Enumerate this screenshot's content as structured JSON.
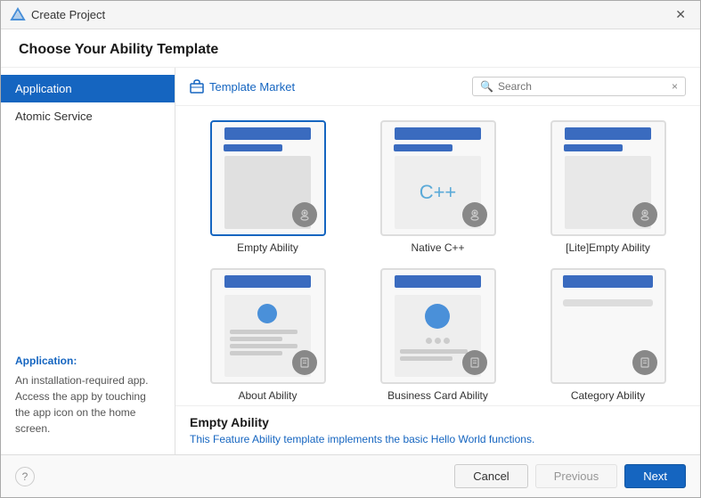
{
  "dialog": {
    "title": "Create Project",
    "heading": "Choose Your Ability Template"
  },
  "sidebar": {
    "items": [
      {
        "id": "application",
        "label": "Application",
        "active": true
      },
      {
        "id": "atomic-service",
        "label": "Atomic Service",
        "active": false
      }
    ],
    "description": {
      "title": "Application:",
      "text": "An installation-required app. Access the app by touching the app icon on the home screen."
    }
  },
  "toolbar": {
    "template_market_label": "Template Market",
    "search_placeholder": "Search",
    "search_clear_icon": "×"
  },
  "templates": [
    {
      "id": "empty-ability",
      "name": "Empty Ability",
      "selected": true,
      "type": "empty"
    },
    {
      "id": "native-cpp",
      "name": "Native C++",
      "selected": false,
      "type": "cpp"
    },
    {
      "id": "lite-empty-ability",
      "name": "[Lite]Empty Ability",
      "selected": false,
      "type": "lite"
    },
    {
      "id": "about-ability",
      "name": "About Ability",
      "selected": false,
      "type": "about"
    },
    {
      "id": "business-card-ability",
      "name": "Business Card Ability",
      "selected": false,
      "type": "bizcard"
    },
    {
      "id": "category-ability",
      "name": "Category Ability",
      "selected": false,
      "type": "category"
    }
  ],
  "selected_template": {
    "name": "Empty Ability",
    "description": "This Feature Ability template implements the basic Hello World functions."
  },
  "footer": {
    "help_icon": "?",
    "cancel_label": "Cancel",
    "previous_label": "Previous",
    "next_label": "Next"
  }
}
